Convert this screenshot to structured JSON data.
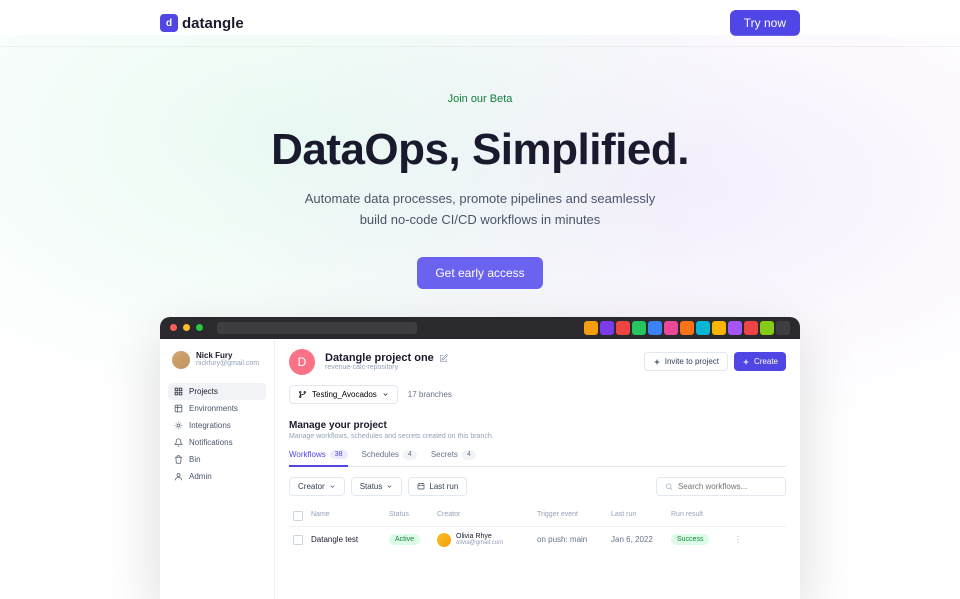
{
  "brand": "datangle",
  "topbar": {
    "cta": "Try now"
  },
  "hero": {
    "badge": "Join our Beta",
    "title": "DataOps, Simplified.",
    "subtitle_l1": "Automate data processes, promote pipelines and seamlessly",
    "subtitle_l2": "build no-code CI/CD workflows in minutes",
    "cta": "Get early access"
  },
  "app": {
    "user": {
      "name": "Nick Fury",
      "email": "nickfury@gmail.com"
    },
    "nav": [
      {
        "label": "Projects"
      },
      {
        "label": "Environments"
      },
      {
        "label": "Integrations"
      },
      {
        "label": "Notifications"
      },
      {
        "label": "Bin"
      },
      {
        "label": "Admin"
      }
    ],
    "project": {
      "initial": "D",
      "name": "Datangle project one",
      "repo": "revenue-calc-repository",
      "invite": "Invite to project",
      "create": "Create"
    },
    "branch": {
      "selected": "Testing_Avocados",
      "count": "17 branches"
    },
    "section": {
      "title": "Manage your project",
      "sub": "Manage workflows, schedules and secrets created on this branch."
    },
    "tabs": [
      {
        "label": "Workflows",
        "count": "38"
      },
      {
        "label": "Schedules",
        "count": "4"
      },
      {
        "label": "Secrets",
        "count": "4"
      }
    ],
    "filters": {
      "creator": "Creator",
      "status": "Status",
      "lastrun": "Last run"
    },
    "search": {
      "placeholder": "Search workflows..."
    },
    "columns": {
      "name": "Name",
      "status": "Status",
      "creator": "Creator",
      "trigger": "Trigger event",
      "lastrun": "Last run",
      "result": "Run result"
    },
    "rows": [
      {
        "name": "Datangle test",
        "status": "Active",
        "creator_name": "Olivia Rhye",
        "creator_email": "olivia@gmail.com",
        "trigger": "on push: main",
        "lastrun": "Jan 6, 2022",
        "result": "Success"
      }
    ]
  },
  "colors": {
    "primary": "#5046e5",
    "success": "#15803d"
  },
  "browser_tab_colors": [
    "#f59e0b",
    "#7c3aed",
    "#ef4444",
    "#22c55e",
    "#3b82f6",
    "#ec4899",
    "#f97316",
    "#06b6d4",
    "#f7b500",
    "#a855f7",
    "#ef4444",
    "#84cc16",
    "#3d3d42"
  ]
}
